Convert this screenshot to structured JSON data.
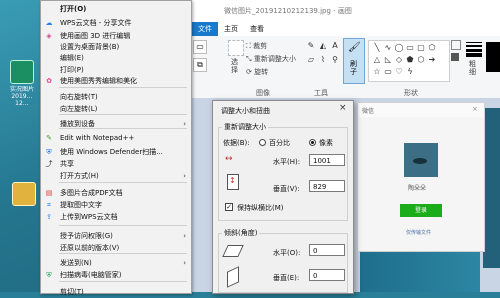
{
  "desktop": {
    "icons": [
      {
        "label": "实况图片\n2019…\n12…"
      },
      {
        "label": ""
      }
    ]
  },
  "context_menu": {
    "items": [
      {
        "label": "打开(O)",
        "bold": true,
        "icon": ""
      },
      {
        "label": "WPS云文档 - 分享文件",
        "icon": "wps-icon"
      },
      {
        "label": "使用画图 3D 进行编辑",
        "icon": "paint3d-icon"
      },
      {
        "label": "设置为桌面背景(B)",
        "icon": ""
      },
      {
        "label": "编辑(E)",
        "icon": ""
      },
      {
        "label": "打印(P)",
        "icon": ""
      },
      {
        "label": "使用美图秀秀编辑和美化",
        "icon": "meitu-icon"
      },
      {
        "label": "向右旋转(T)",
        "icon": ""
      },
      {
        "label": "向左旋转(L)",
        "icon": ""
      },
      {
        "label": "播放到设备",
        "icon": "",
        "submenu": true
      },
      {
        "label": "Edit with Notepad++",
        "icon": "notepad-icon"
      },
      {
        "label": "使用 Windows Defender扫描...",
        "icon": "defender-icon"
      },
      {
        "label": "共享",
        "icon": "share-icon"
      },
      {
        "label": "打开方式(H)",
        "icon": "",
        "submenu": true
      },
      {
        "label": "多图片合成PDF文档",
        "icon": "pdf-icon"
      },
      {
        "label": "提取图中文字",
        "icon": "ocr-icon"
      },
      {
        "label": "上传到WPS云文档",
        "icon": "upload-icon"
      },
      {
        "label": "授予访问权限(G)",
        "icon": "",
        "submenu": true
      },
      {
        "label": "还原以前的版本(V)",
        "icon": ""
      },
      {
        "label": "发送到(N)",
        "icon": "",
        "submenu": true
      },
      {
        "label": "扫描病毒(电脑管家)",
        "icon": "antivirus-icon"
      },
      {
        "label": "剪切(T)",
        "icon": ""
      }
    ]
  },
  "paint": {
    "title": "微信图片_20191210212139.jpg - 画图",
    "tabs": [
      "文件",
      "主页",
      "查看"
    ],
    "ribbon": {
      "select_label": "选\n择",
      "crop_label": "裁剪",
      "resize_label": "重新调整大小",
      "rotate_label": "旋转",
      "image_group": "图像",
      "tools_group": "工具",
      "brush_label": "刷\n子",
      "shapes_group": "形状",
      "thickness_label": "粗\n细"
    }
  },
  "dialog": {
    "title": "调整大小和扭曲",
    "resize_group": "重新调整大小",
    "by_label": "依据(B):",
    "percent_label": "百分比",
    "pixels_label": "像素",
    "percent_selected": false,
    "pixels_selected": true,
    "horizontal_label": "水平(H):",
    "horizontal_value": "1001",
    "vertical_label": "垂直(V):",
    "vertical_value": "829",
    "keep_ratio_label": "保持纵横比(M)",
    "keep_ratio_checked": true,
    "skew_group": "倾斜(角度)",
    "skew_horizontal_label": "水平(O):",
    "skew_horizontal_value": "0",
    "skew_vertical_label": "垂直(E):",
    "skew_vertical_value": "0"
  },
  "wechat": {
    "title": "微信",
    "caption": "陶朵朵",
    "button_label": "登录",
    "link_label": "仅传输文件",
    "accent": "#1aad19"
  }
}
